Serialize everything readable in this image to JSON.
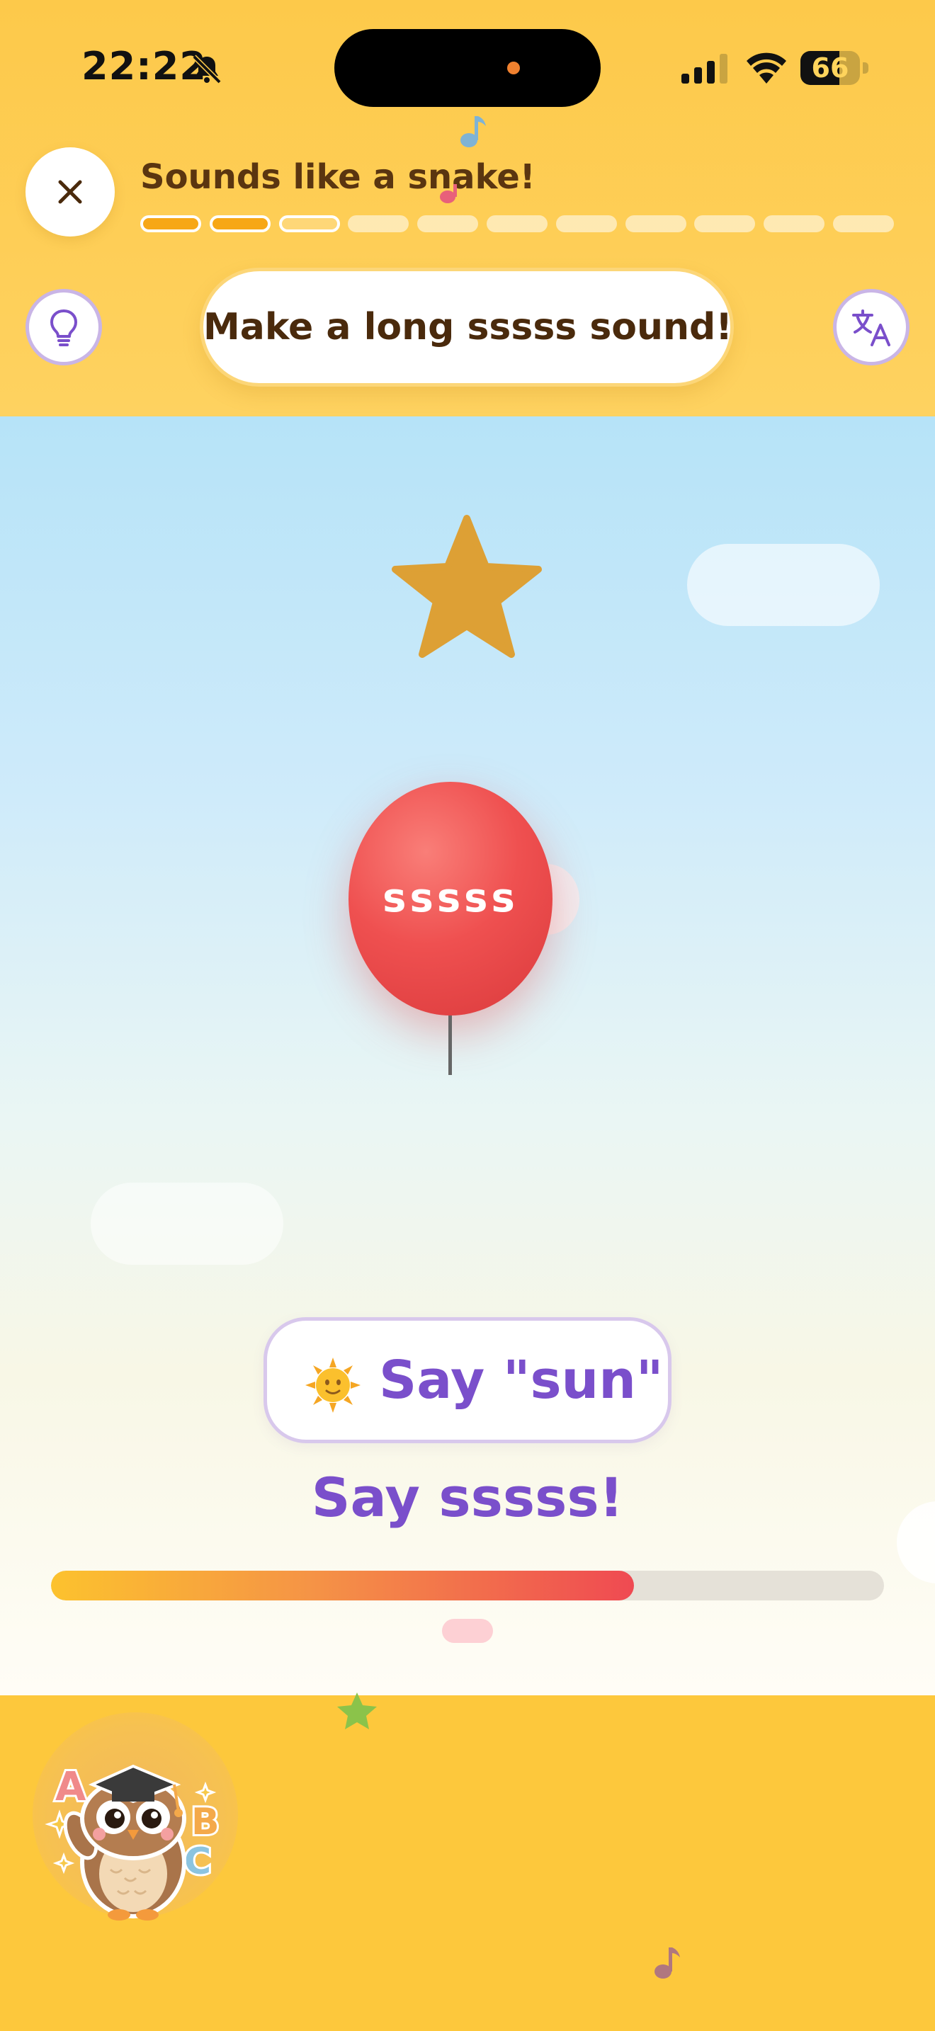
{
  "status_bar": {
    "time": "22:22",
    "battery": "66",
    "battery_level": 0.66,
    "icons": [
      "bell-slash-icon",
      "cellular-signal-icon",
      "wifi-icon",
      "battery-icon"
    ]
  },
  "header": {
    "title": "Sounds like a snake!",
    "progress_total": 11,
    "progress_done": 2,
    "progress_current_index": 2,
    "close_icon": "close-icon"
  },
  "toolbar": {
    "hint_icon": "lightbulb-icon",
    "translate_icon": "translate-icon",
    "instruction": "Make a long sssss sound!"
  },
  "scene": {
    "star_icon": "star-icon",
    "balloon_label": "sssss",
    "balloon_color": "#EF5050",
    "star_color": "#DDA035"
  },
  "prompt": {
    "emoji": "sun-emoji-icon",
    "say_label": "Say \"sun\"",
    "instruction": "Say sssss!",
    "volume_level": 0.7
  },
  "colors": {
    "accent_purple": "#7A4FCB",
    "brand_yellow": "#FDC83C",
    "title_brown": "#5A3510",
    "progress_orange": "#F7A716"
  },
  "mascot": {
    "icon": "owl-mascot-icon",
    "letters": [
      "A",
      "B",
      "C"
    ]
  }
}
